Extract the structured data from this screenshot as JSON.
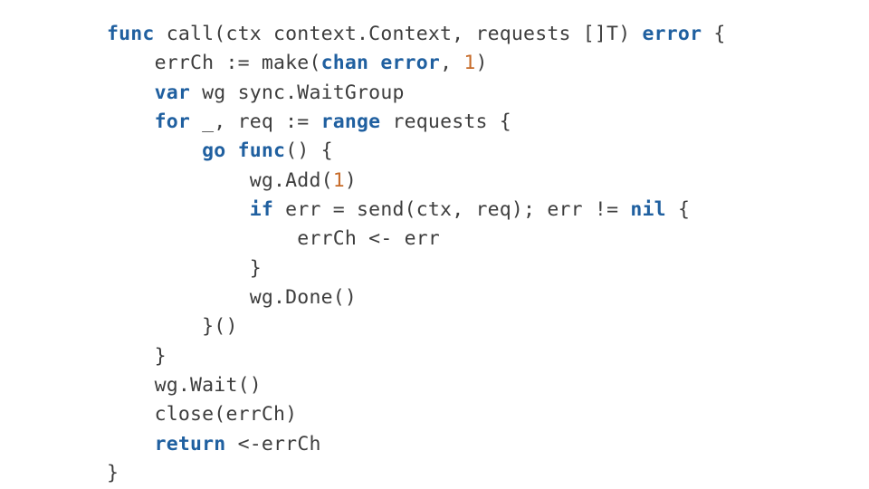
{
  "code": {
    "tokens": [
      {
        "t": "func",
        "c": "kw"
      },
      {
        "t": " call(ctx context.Context, requests []T) ",
        "c": "fn"
      },
      {
        "t": "error",
        "c": "kw"
      },
      {
        "t": " {",
        "c": "fn"
      },
      {
        "t": "\n",
        "c": ""
      },
      {
        "t": "    errCh := make(",
        "c": "fn"
      },
      {
        "t": "chan",
        "c": "kw"
      },
      {
        "t": " ",
        "c": "fn"
      },
      {
        "t": "error",
        "c": "kw"
      },
      {
        "t": ", ",
        "c": "fn"
      },
      {
        "t": "1",
        "c": "num"
      },
      {
        "t": ")",
        "c": "fn"
      },
      {
        "t": "\n",
        "c": ""
      },
      {
        "t": "    ",
        "c": "fn"
      },
      {
        "t": "var",
        "c": "kw"
      },
      {
        "t": " wg sync.WaitGroup",
        "c": "fn"
      },
      {
        "t": "\n",
        "c": ""
      },
      {
        "t": "    ",
        "c": "fn"
      },
      {
        "t": "for",
        "c": "kw"
      },
      {
        "t": " _, req := ",
        "c": "fn"
      },
      {
        "t": "range",
        "c": "kw"
      },
      {
        "t": " requests {",
        "c": "fn"
      },
      {
        "t": "\n",
        "c": ""
      },
      {
        "t": "        ",
        "c": "fn"
      },
      {
        "t": "go",
        "c": "kw"
      },
      {
        "t": " ",
        "c": "fn"
      },
      {
        "t": "func",
        "c": "kw"
      },
      {
        "t": "() {",
        "c": "fn"
      },
      {
        "t": "\n",
        "c": ""
      },
      {
        "t": "            wg.Add(",
        "c": "fn"
      },
      {
        "t": "1",
        "c": "num"
      },
      {
        "t": ")",
        "c": "fn"
      },
      {
        "t": "\n",
        "c": ""
      },
      {
        "t": "            ",
        "c": "fn"
      },
      {
        "t": "if",
        "c": "kw"
      },
      {
        "t": " err = send(ctx, req); err != ",
        "c": "fn"
      },
      {
        "t": "nil",
        "c": "kw"
      },
      {
        "t": " {",
        "c": "fn"
      },
      {
        "t": "\n",
        "c": ""
      },
      {
        "t": "                errCh <- err",
        "c": "fn"
      },
      {
        "t": "\n",
        "c": ""
      },
      {
        "t": "            }",
        "c": "fn"
      },
      {
        "t": "\n",
        "c": ""
      },
      {
        "t": "            wg.Done()",
        "c": "fn"
      },
      {
        "t": "\n",
        "c": ""
      },
      {
        "t": "        }()",
        "c": "fn"
      },
      {
        "t": "\n",
        "c": ""
      },
      {
        "t": "    }",
        "c": "fn"
      },
      {
        "t": "\n",
        "c": ""
      },
      {
        "t": "    wg.Wait()",
        "c": "fn"
      },
      {
        "t": "\n",
        "c": ""
      },
      {
        "t": "    close(errCh)",
        "c": "fn"
      },
      {
        "t": "\n",
        "c": ""
      },
      {
        "t": "    ",
        "c": "fn"
      },
      {
        "t": "return",
        "c": "kw"
      },
      {
        "t": " <-errCh",
        "c": "fn"
      },
      {
        "t": "\n",
        "c": ""
      },
      {
        "t": "}",
        "c": "fn"
      }
    ]
  }
}
